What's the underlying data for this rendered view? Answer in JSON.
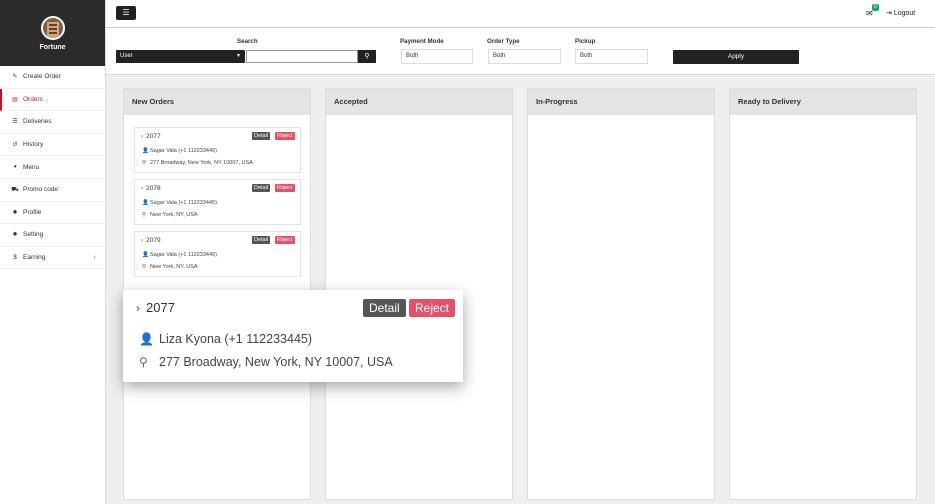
{
  "brand": {
    "name": "Fortune"
  },
  "sidebar": {
    "items": [
      {
        "label": "Create Order",
        "icon": "edit-icon"
      },
      {
        "label": "Orders",
        "icon": "orders-icon"
      },
      {
        "label": "Deliveries",
        "icon": "list-icon"
      },
      {
        "label": "History",
        "icon": "history-icon"
      },
      {
        "label": "Menu",
        "icon": "menu-icon"
      },
      {
        "label": "Promo code",
        "icon": "cart-icon"
      },
      {
        "label": "Profile",
        "icon": "gear-icon"
      },
      {
        "label": "Setting",
        "icon": "gear-icon"
      },
      {
        "label": "Earning",
        "icon": "dollar-icon"
      }
    ]
  },
  "header": {
    "mail_count": "0",
    "logout_label": "Logout"
  },
  "filters": {
    "search_label": "Search",
    "user_select": "User",
    "payment_label": "Payment Mode",
    "payment_value": "Both",
    "order_type_label": "Order Type",
    "order_type_value": "Both",
    "pickup_label": "Pickup",
    "pickup_value": "Both",
    "apply_label": "Apply"
  },
  "columns": {
    "new": "New Orders",
    "accepted": "Accepted",
    "progress": "In-Progress",
    "ready": "Ready to Delivery"
  },
  "orders": [
    {
      "number": "2077",
      "customer": "Sagar Vala (+1 112233445)",
      "address": "277 Broadway, New York, NY 10007, USA"
    },
    {
      "number": "2078",
      "customer": "Sagar Vala (+1 112233445)",
      "address": "New York, NY, USA"
    },
    {
      "number": "2079",
      "customer": "Sagar Vala (+1 112233445)",
      "address": "New York, NY, USA"
    }
  ],
  "buttons": {
    "detail": "Detail",
    "reject": "Reject"
  },
  "zoom": {
    "number": "2077",
    "customer": "Liza Kyona (+1 112233445)",
    "address": "277 Broadway, New York, NY 10007, USA"
  },
  "colors": {
    "accent": "#c8102e",
    "reject": "#e8506a",
    "dark": "#222222",
    "badge": "#1ea37a"
  }
}
